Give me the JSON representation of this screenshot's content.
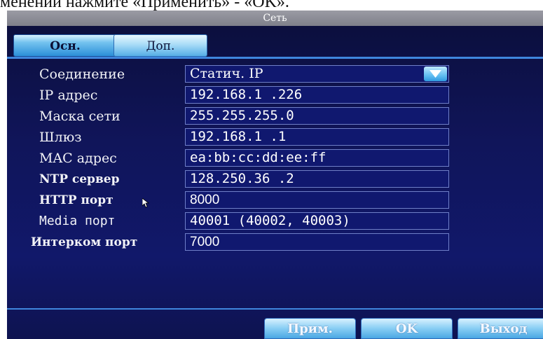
{
  "caption": "менений нажмите «Применить» - «OK».",
  "window": {
    "title": "Сеть"
  },
  "tabs": [
    {
      "label": "Осн.",
      "active": true
    },
    {
      "label": "Доп.",
      "active": false
    }
  ],
  "form": {
    "connection": {
      "label": "Соединение",
      "value": "Статич. IP"
    },
    "ip": {
      "label": "IP адрес",
      "value": "192.168.1  .226"
    },
    "mask": {
      "label": "Маска сети",
      "value": "255.255.255.0"
    },
    "gateway": {
      "label": "Шлюз",
      "value": "192.168.1  .1"
    },
    "mac": {
      "label": "MAC адрес",
      "value": "ea:bb:cc:dd:ee:ff"
    },
    "ntp": {
      "label": "NTP сервер",
      "value": "128.250.36 .2"
    },
    "http": {
      "label": "HTTP порт",
      "value": "8000"
    },
    "media": {
      "label": "Media порт",
      "value": "40001 (40002, 40003)"
    },
    "intercom": {
      "label": "Интерком порт",
      "value": "7000"
    }
  },
  "buttons": {
    "apply": "Прим.",
    "ok": "OK",
    "exit": "Выход"
  },
  "icons": {
    "dropdown": "chevron-down-icon",
    "pointer": "mouse-pointer-icon"
  },
  "colors": {
    "background": "#10155a",
    "accent": "#3f86dd",
    "titlebar": "#8a8b95"
  }
}
